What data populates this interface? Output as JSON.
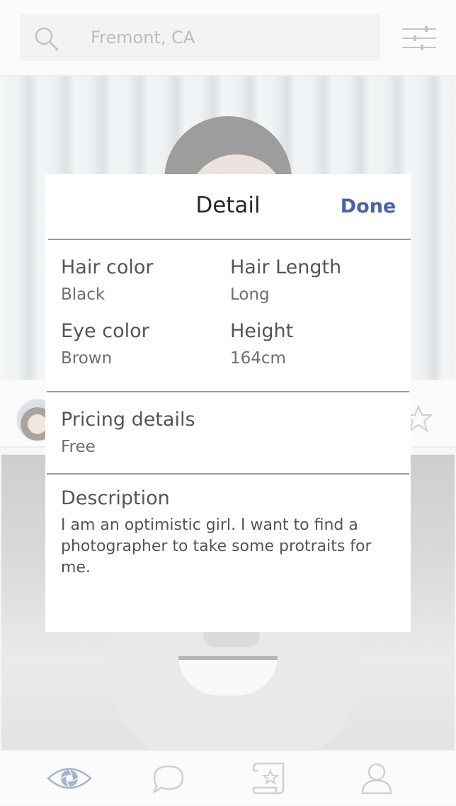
{
  "search": {
    "value": "Fremont, CA"
  },
  "modal": {
    "title": "Detail",
    "done_label": "Done",
    "attributes": [
      {
        "label": "Hair color",
        "value": "Black"
      },
      {
        "label": "Hair Length",
        "value": "Long"
      },
      {
        "label": "Eye color",
        "value": "Brown"
      },
      {
        "label": "Height",
        "value": "164cm"
      }
    ],
    "pricing": {
      "label": "Pricing details",
      "value": "Free"
    },
    "description": {
      "label": "Description",
      "text": "I am an optimistic girl. I want to find a photographer to take some protraits for me."
    }
  },
  "tabs": [
    {
      "icon": "eye-aperture-icon",
      "active": true
    },
    {
      "icon": "chat-bubble-icon",
      "active": false
    },
    {
      "icon": "scroll-star-icon",
      "active": false
    },
    {
      "icon": "user-icon",
      "active": false
    }
  ],
  "colors": {
    "accent": "#4864a6",
    "modal_bg": "#ffffff",
    "divider": "#9b9b9b",
    "label_text": "#555555",
    "value_text": "#6e6e6e"
  }
}
